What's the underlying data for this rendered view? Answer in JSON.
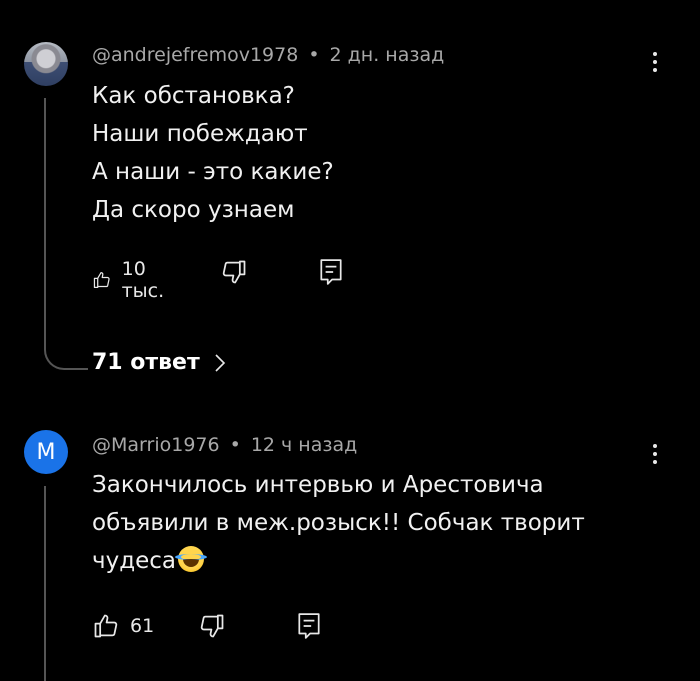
{
  "comments": [
    {
      "author": "@andrejefremov1978",
      "separator": "•",
      "time": "2 дн. назад",
      "text": "Как обстановка?\nНаши побеждают\nА наши - это какие?\nДа скоро узнаем",
      "likes": "10 тыс.",
      "replies_label": "71 ответ"
    },
    {
      "avatar_letter": "M",
      "author": "@Marrio1976",
      "separator": "•",
      "time": "12 ч назад",
      "text": "Закончилось интервью и Арестовича\nобъявили в меж.розыск!! Собчак творит\nчудеса",
      "emoji": "face-with-tears-of-joy",
      "likes": "61"
    }
  ],
  "colors": {
    "background": "#000000",
    "text": "#f1f1f1",
    "meta": "#a8a8a8",
    "avatar_blue": "#1a73e8"
  }
}
